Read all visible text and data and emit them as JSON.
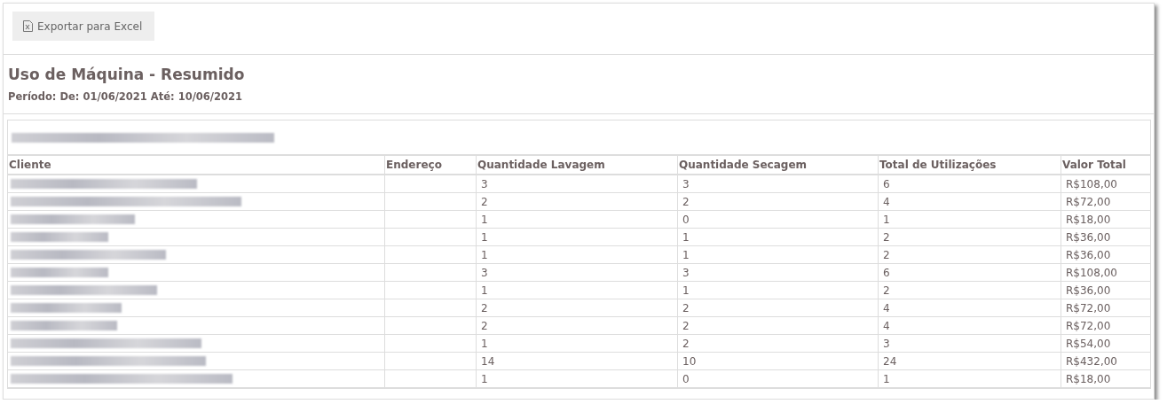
{
  "toolbar": {
    "export_button": "Exportar para Excel"
  },
  "report": {
    "title": "Uso de Máquina - Resumido",
    "period": "Período: De: 01/06/2021 Até: 10/06/2021"
  },
  "table": {
    "columns": [
      "Cliente",
      "Endereço",
      "Quantidade Lavagem",
      "Quantidade Secagem",
      "Total de Utilizações",
      "Valor Total"
    ],
    "rows": [
      {
        "lavagem": "3",
        "secagem": "3",
        "total": "6",
        "valor": "R$108,00"
      },
      {
        "lavagem": "2",
        "secagem": "2",
        "total": "4",
        "valor": "R$72,00"
      },
      {
        "lavagem": "1",
        "secagem": "0",
        "total": "1",
        "valor": "R$18,00"
      },
      {
        "lavagem": "1",
        "secagem": "1",
        "total": "2",
        "valor": "R$36,00"
      },
      {
        "lavagem": "1",
        "secagem": "1",
        "total": "2",
        "valor": "R$36,00"
      },
      {
        "lavagem": "3",
        "secagem": "3",
        "total": "6",
        "valor": "R$108,00"
      },
      {
        "lavagem": "1",
        "secagem": "1",
        "total": "2",
        "valor": "R$36,00"
      },
      {
        "lavagem": "2",
        "secagem": "2",
        "total": "4",
        "valor": "R$72,00"
      },
      {
        "lavagem": "2",
        "secagem": "2",
        "total": "4",
        "valor": "R$72,00"
      },
      {
        "lavagem": "1",
        "secagem": "2",
        "total": "3",
        "valor": "R$54,00"
      },
      {
        "lavagem": "14",
        "secagem": "10",
        "total": "24",
        "valor": "R$432,00"
      },
      {
        "lavagem": "1",
        "secagem": "0",
        "total": "1",
        "valor": "R$18,00"
      }
    ]
  }
}
